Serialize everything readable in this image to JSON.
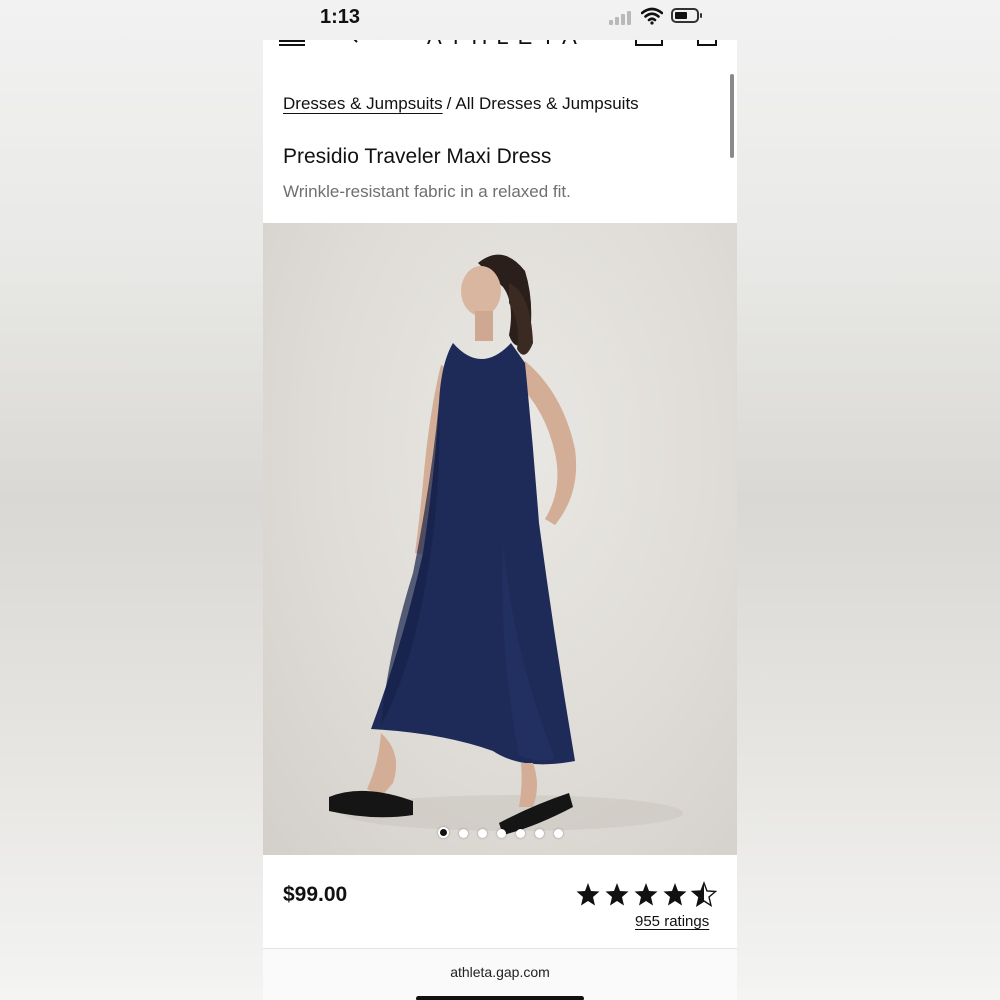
{
  "status_bar": {
    "time": "1:13"
  },
  "site": {
    "logo": "ATHLETA",
    "url": "athleta.gap.com"
  },
  "breadcrumb": {
    "items": [
      "Dresses & Jumpsuits",
      "All Dresses & Jumpsuits"
    ],
    "separator": "/"
  },
  "product": {
    "title": "Presidio Traveler Maxi Dress",
    "subtitle": "Wrinkle-resistant fabric in a relaxed fit.",
    "price": "$99.00",
    "rating": {
      "stars": 4.5,
      "max": 5,
      "ratings_label": "955 ratings"
    },
    "carousel": {
      "total": 7,
      "active": 0
    }
  },
  "colors": {
    "dress_navy": "#1e2b58",
    "text": "#111111",
    "subtitle": "#6f6f6f"
  },
  "icons": [
    "menu-icon",
    "search-icon",
    "account-icon",
    "bag-icon",
    "signal-icon",
    "wifi-icon",
    "battery-icon",
    "star-icon"
  ]
}
